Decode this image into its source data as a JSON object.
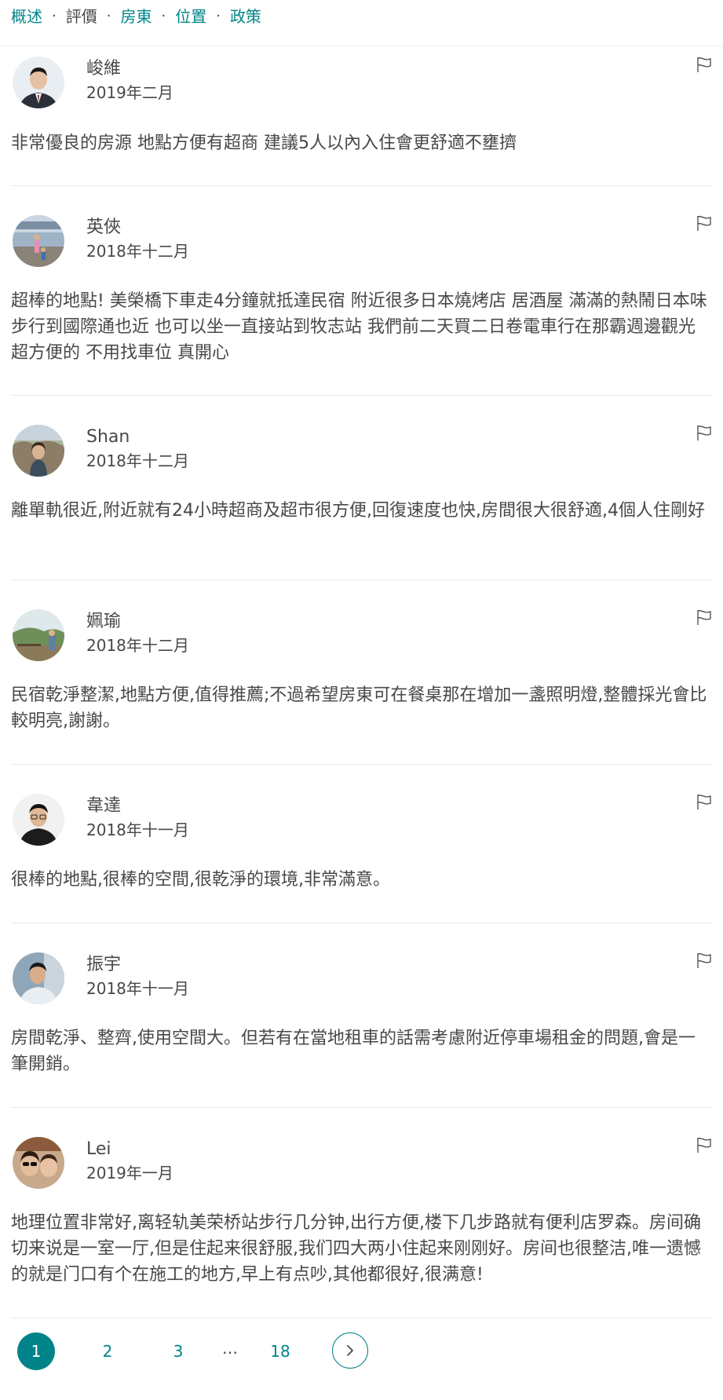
{
  "nav": {
    "items": [
      {
        "label": "概述"
      },
      {
        "label": "評價"
      },
      {
        "label": "房東"
      },
      {
        "label": "位置"
      },
      {
        "label": "政策"
      }
    ],
    "separator": "·",
    "active_index": 1
  },
  "reviews": [
    {
      "name": "峻維",
      "date": "2019年二月",
      "text": "非常優良的房源 地點方便有超商 建議5人以內入住會更舒適不壅擠",
      "avatar_icon": "avatar-man-suit"
    },
    {
      "name": "英俠",
      "date": "2018年十二月",
      "text": "超棒的地點! 美榮橋下車走4分鐘就抵達民宿 附近很多日本燒烤店 居酒屋 滿滿的熱鬧日本味 步行到國際通也近 也可以坐一直接站到牧志站 我們前二天買二日卷電車行在那霸週邊觀光 超方便的 不用找車位 真開心",
      "avatar_icon": "avatar-outdoor-photo"
    },
    {
      "name": "Shan",
      "date": "2018年十二月",
      "text": "離單軌很近,附近就有24小時超商及超市很方便,回復速度也快,房間很大很舒適,4個人住剛好",
      "avatar_icon": "avatar-woman-rocks"
    },
    {
      "name": "姵瑜",
      "date": "2018年十二月",
      "text": "民宿乾淨整潔,地點方便,值得推薦;不過希望房東可在餐桌那在增加一盞照明燈,整體採光會比較明亮,謝謝。",
      "avatar_icon": "avatar-garden-photo"
    },
    {
      "name": "韋達",
      "date": "2018年十一月",
      "text": "很棒的地點,很棒的空間,很乾淨的環境,非常滿意。",
      "avatar_icon": "avatar-man-glasses"
    },
    {
      "name": "振宇",
      "date": "2018年十一月",
      "text": "房間乾淨、整齊,使用空間大。但若有在當地租車的話需考慮附近停車場租金的問題,會是一筆開銷。",
      "avatar_icon": "avatar-man-shirt"
    },
    {
      "name": "Lei",
      "date": "2019年一月",
      "text": "地理位置非常好,离轻轨美荣桥站步行几分钟,出行方便,楼下几步路就有便利店罗森。房间确切来说是一室一厅,但是住起来很舒服,我们四大两小住起来刚刚好。房间也很整洁,唯一遗憾的就是门口有个在施工的地方,早上有点吵,其他都很好,很满意!",
      "avatar_icon": "avatar-couple-selfie"
    }
  ],
  "pagination": {
    "pages": [
      "1",
      "2",
      "3",
      "18"
    ],
    "current": "1",
    "ellipsis": "…",
    "next_icon": "chevron-right-icon"
  },
  "colors": {
    "accent": "#008489",
    "text": "#484848",
    "divider": "#ebebeb"
  }
}
